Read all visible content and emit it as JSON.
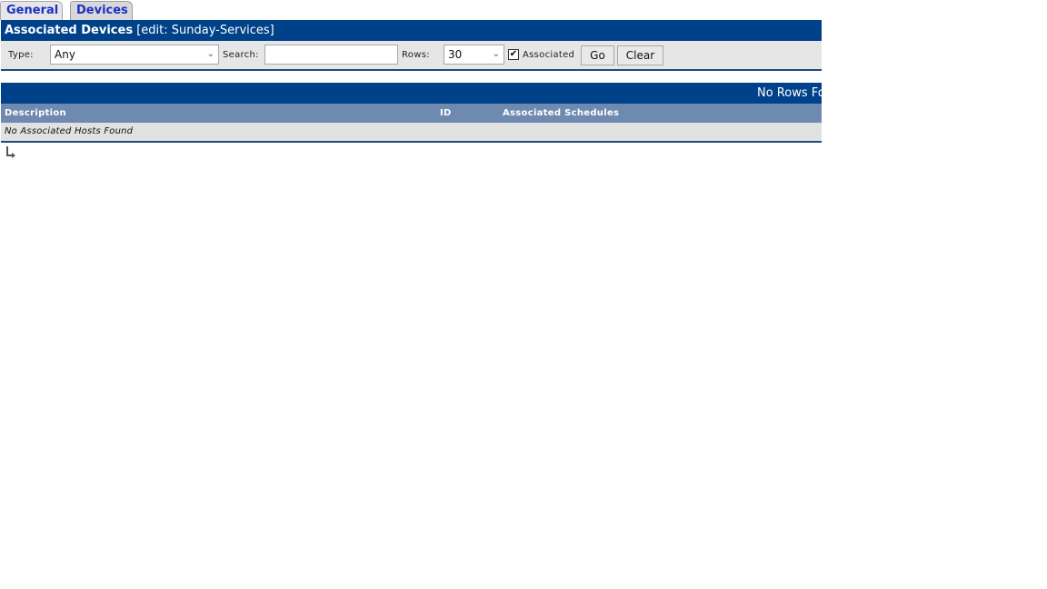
{
  "tabs": [
    {
      "label": "General",
      "active": false
    },
    {
      "label": "Devices",
      "active": true
    }
  ],
  "panel": {
    "title": "Associated Devices",
    "subtitle": "[edit: Sunday-Services]",
    "filters": {
      "type_label": "Type:",
      "type_value": "Any",
      "search_label": "Search:",
      "search_value": "",
      "rows_label": "Rows:",
      "rows_value": "30",
      "associated_label": "Associated",
      "associated_checked": true,
      "go_label": "Go",
      "clear_label": "Clear"
    }
  },
  "grid": {
    "status": "No Rows Found",
    "columns": [
      "Description",
      "ID",
      "Associated Schedules"
    ],
    "empty_message": "No Associated Hosts Found"
  },
  "icons": {
    "return": "return-arrow-icon",
    "check": "✔",
    "dropdown": "⌄"
  }
}
